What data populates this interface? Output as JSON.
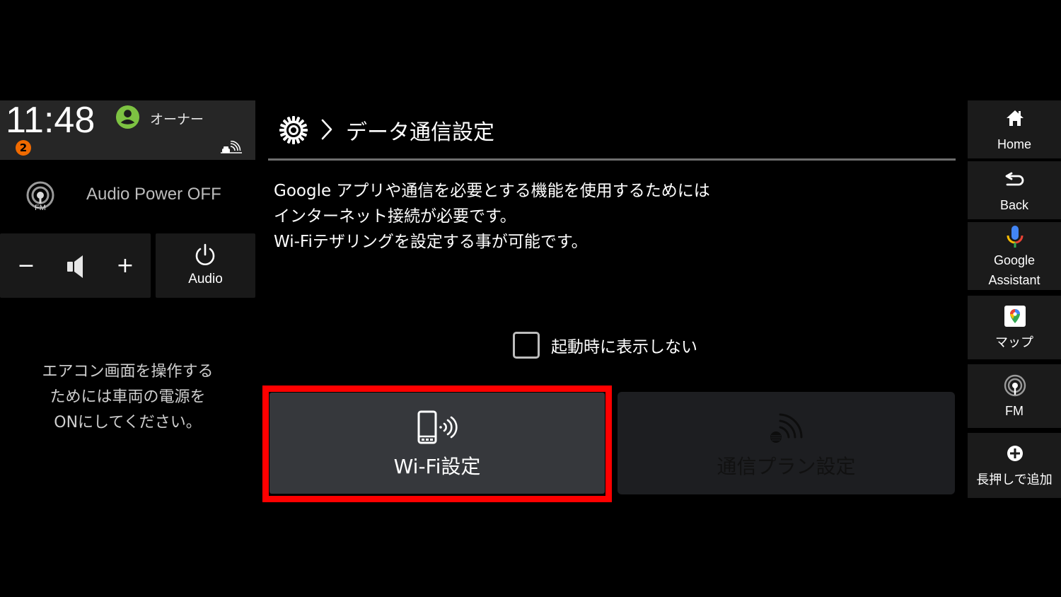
{
  "status": {
    "clock": "11:48",
    "owner_name": "オーナー",
    "notification_count": "2"
  },
  "audio": {
    "status_text": "Audio Power OFF",
    "source_icon_label": "FM",
    "vol_minus": "−",
    "vol_plus": "+",
    "power_label": "Audio"
  },
  "climate": {
    "message_lines": [
      "エアコン画面を操作する",
      "ためには車両の電源を",
      "ONにしてください。"
    ]
  },
  "main": {
    "breadcrumb_title": "データ通信設定",
    "description_lines": [
      "Google アプリや通信を必要とする機能を使用するためには",
      "インターネット接続が必要です。",
      "Wi-Fiテザリングを設定する事が可能です。"
    ],
    "checkbox_label": "起動時に表示しない",
    "checkbox_checked": false,
    "wifi_button_label": "Wi-Fi設定",
    "plan_button_label": "通信プラン設定",
    "highlight_color": "#ff0000"
  },
  "rail": {
    "items": [
      {
        "label": "Home"
      },
      {
        "label": "Back"
      },
      {
        "label_line1": "Google",
        "label_line2": "Assistant"
      },
      {
        "label": "マップ"
      },
      {
        "label": "FM"
      },
      {
        "label": "長押しで追加"
      }
    ]
  },
  "colors": {
    "owner_green": "#7dc242",
    "badge_orange": "#f06a00",
    "wifi_button_bg": "#36383c",
    "plan_button_bg": "#1d1e21"
  }
}
